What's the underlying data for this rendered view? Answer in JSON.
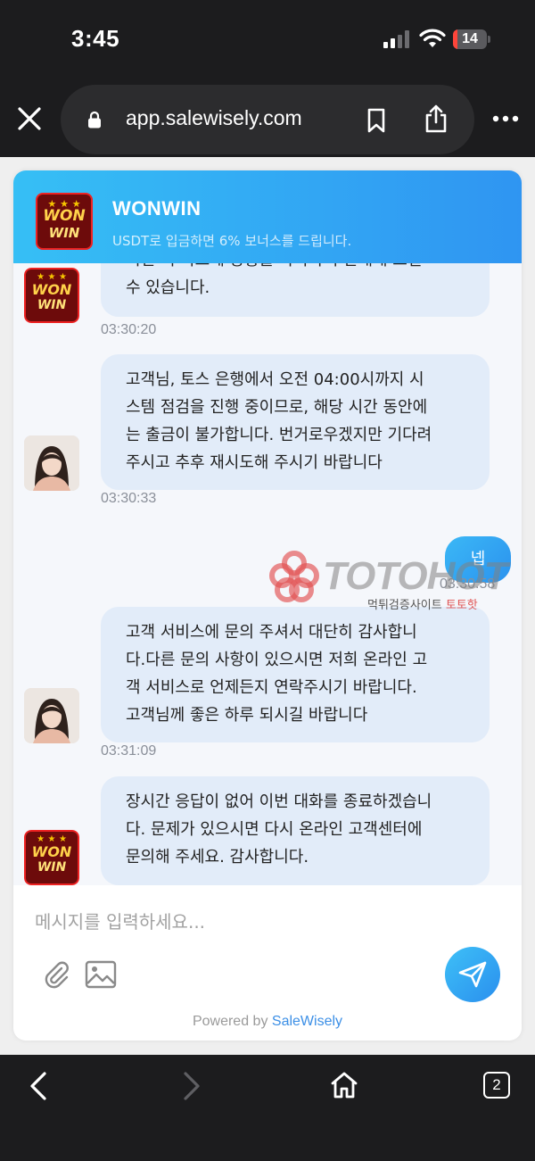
{
  "status_bar": {
    "time": "3:45",
    "battery": "14",
    "battery_level": 0.14
  },
  "browser": {
    "url": "app.salewisely.com",
    "tab_count": "2"
  },
  "chat": {
    "brand_name": "WONWIN",
    "subtitle": "USDT로 입금하면 6% 보너스를 드립니다.",
    "logo_text_top": "WON",
    "logo_text_bottom": "WIN",
    "messages": [
      {
        "sender": "bot",
        "avatar": "logo",
        "lines": [
          "시면 더 빠르게 상황을 파악하여 안내해 드릴",
          "수 있습니다."
        ],
        "time": "03:30:20"
      },
      {
        "sender": "agent",
        "avatar": "person",
        "lines": [
          "고객님, 토스 은행에서 오전 04:00시까지 시",
          "스템 점검을 진행 중이므로, 해당 시간 동안에",
          "는 출금이 불가합니다. 번거로우겠지만 기다려",
          "주시고 추후 재시도해 주시기 바랍니다"
        ],
        "time": "03:30:33"
      },
      {
        "sender": "user",
        "text": "넵",
        "time": "03:30:58"
      },
      {
        "sender": "agent",
        "avatar": "person",
        "lines": [
          "고객 서비스에 문의 주셔서 대단히 감사합니",
          "다.다른 문의 사항이 있으시면 저희 온라인 고",
          "객 서비스로 언제든지 연락주시기 바랍니다.",
          "고객님께 좋은 하루 되시길 바랍니다"
        ],
        "time": "03:31:09"
      },
      {
        "sender": "bot",
        "avatar": "logo",
        "lines": [
          "장시간 응답이 없어 이번 대화를 종료하겠습니",
          "다. 문제가 있으시면 다시 온라인 고객센터에",
          "문의해 주세요. 감사합니다."
        ]
      }
    ],
    "composer_placeholder": "메시지를 입력하세요...",
    "powered_prefix": "Powered by ",
    "powered_link": "SaleWisely"
  },
  "watermark": {
    "text": "TOTOHOT",
    "sub": "먹튀검증사이트 ",
    "sub_red": "토토핫"
  },
  "icons": {
    "close": "close-icon",
    "lock": "lock-icon",
    "bookmark": "bookmark-icon",
    "share": "share-icon",
    "more": "more-icon",
    "attach": "paperclip-icon",
    "image": "image-icon",
    "send": "send-icon",
    "back": "back-icon",
    "forward": "forward-icon",
    "home": "home-icon"
  },
  "colors": {
    "header_gradient_start": "#36bff5",
    "header_gradient_end": "#2f95f2",
    "bubble_bg": "#e2ecf9",
    "link": "#3c8fe6"
  }
}
